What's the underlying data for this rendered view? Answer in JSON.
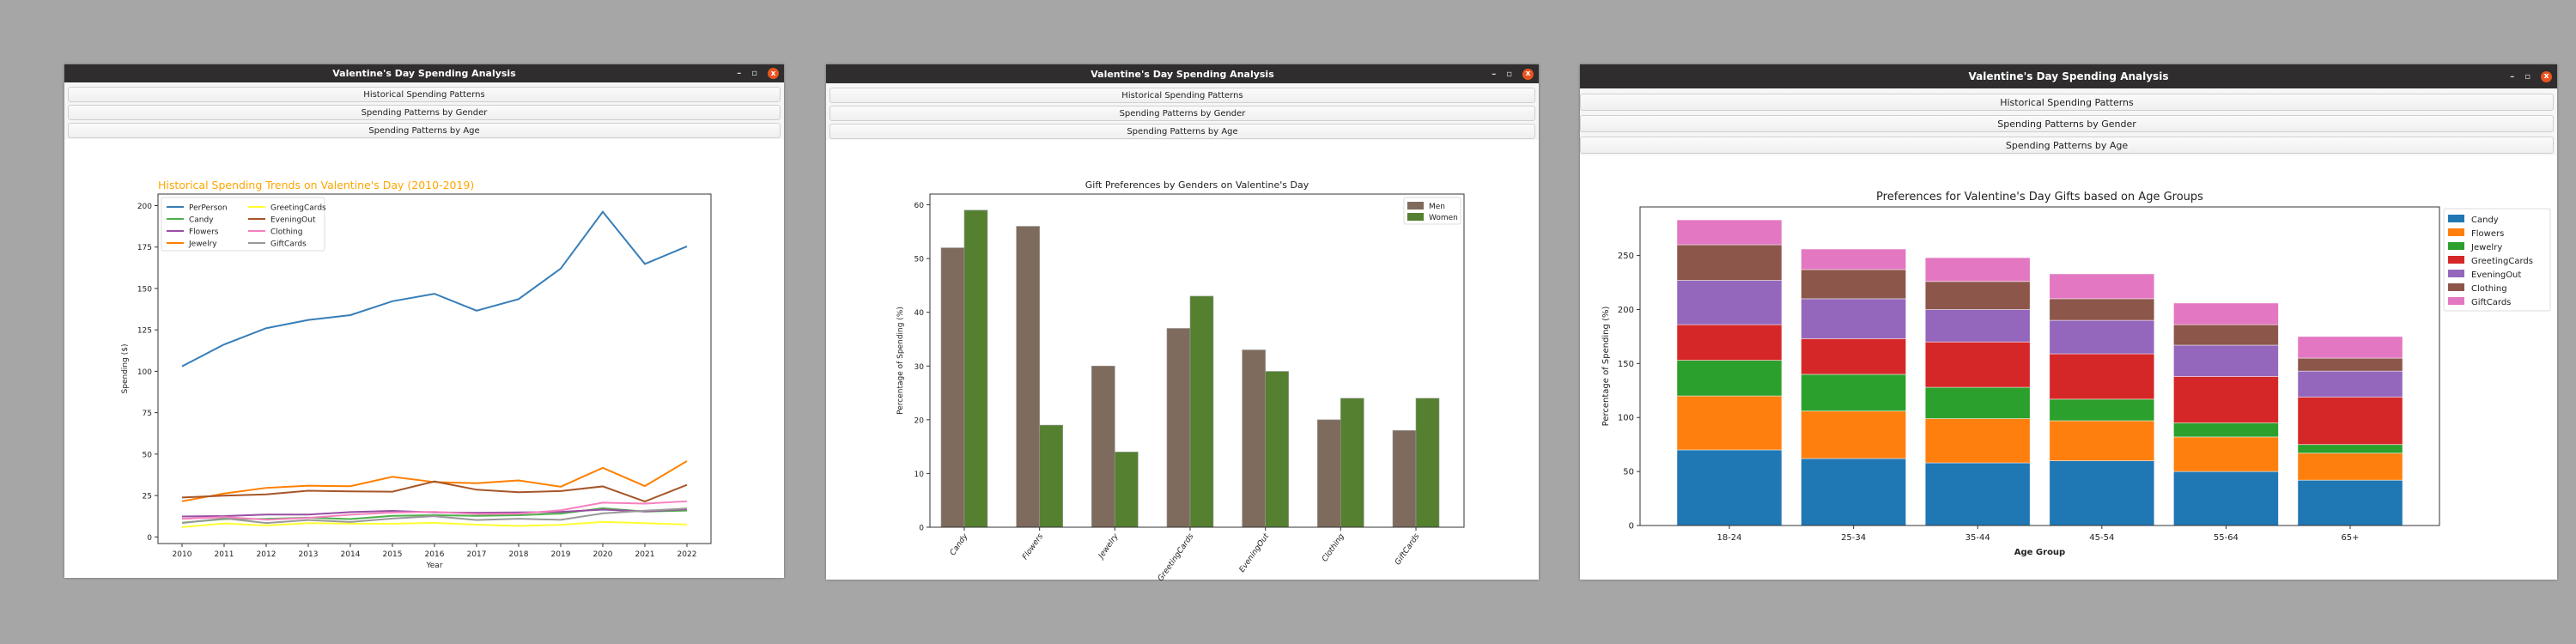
{
  "windows": [
    {
      "title": "Valentine's Day Spending Analysis",
      "buttons": [
        "Historical Spending Patterns",
        "Spending Patterns by Gender",
        "Spending Patterns by Age"
      ],
      "controls": {
        "minimize": "–",
        "maximize": "▫",
        "close": "x"
      }
    },
    {
      "title": "Valentine's Day Spending Analysis",
      "buttons": [
        "Historical Spending Patterns",
        "Spending Patterns by Gender",
        "Spending Patterns by Age"
      ],
      "controls": {
        "minimize": "–",
        "maximize": "▫",
        "close": "x"
      }
    },
    {
      "title": "Valentine's Day Spending Analysis",
      "buttons": [
        "Historical Spending Patterns",
        "Spending Patterns by Gender",
        "Spending Patterns by Age"
      ],
      "controls": {
        "minimize": "–",
        "maximize": "▫",
        "close": "x"
      }
    }
  ],
  "chart_data": [
    {
      "type": "line",
      "title": "Historical Spending Trends on Valentine's Day (2010-2019)",
      "title_color": "#ffa500",
      "xlabel": "Year",
      "ylabel": "Spending ($)",
      "x": [
        2010,
        2011,
        2012,
        2013,
        2014,
        2015,
        2016,
        2017,
        2018,
        2019,
        2020,
        2021,
        2022
      ],
      "ylim": [
        -4,
        207
      ],
      "yticks": [
        0,
        25,
        50,
        75,
        100,
        125,
        150,
        175,
        200
      ],
      "legend": "top-left",
      "series": [
        {
          "name": "PerPerson",
          "color": "#377eb8",
          "values": [
            103,
            116.2,
            126,
            131,
            133.9,
            142.3,
            146.8,
            136.6,
            143.6,
            162,
            196.3,
            164.8,
            175.4
          ]
        },
        {
          "name": "Candy",
          "color": "#4daf4a",
          "values": [
            8.6,
            10.8,
            10.9,
            11.6,
            10.8,
            12.7,
            13.1,
            12.7,
            13.1,
            14.1,
            17.3,
            15.3,
            15.9
          ]
        },
        {
          "name": "Flowers",
          "color": "#984ea3",
          "values": [
            12.3,
            12.6,
            13.5,
            13.5,
            15,
            15.7,
            14.8,
            14.6,
            14.8,
            15.1,
            16.5,
            15.4,
            16.7
          ]
        },
        {
          "name": "Jewelry",
          "color": "#ff7f00",
          "values": [
            21.5,
            26.2,
            29.6,
            30.9,
            30.6,
            36.3,
            33.1,
            32.4,
            34.1,
            30.3,
            41.7,
            30.7,
            45.8
          ]
        },
        {
          "name": "GreetingCards",
          "color": "#ffff33",
          "values": [
            5.9,
            8.1,
            6.9,
            8.3,
            8,
            7.9,
            8.5,
            7.4,
            6.6,
            7.3,
            9,
            8.3,
            7.5
          ]
        },
        {
          "name": "EveningOut",
          "color": "#a65628",
          "values": [
            23.8,
            24.9,
            25.7,
            27.9,
            27.5,
            27.3,
            33.5,
            28.5,
            27,
            27.7,
            30.5,
            21.4,
            31.4
          ]
        },
        {
          "name": "Clothing",
          "color": "#f781bf",
          "values": [
            10.9,
            12,
            10.4,
            11.5,
            13.4,
            14.7,
            15.1,
            13.9,
            14,
            16.1,
            20.7,
            20.1,
            21.5
          ]
        },
        {
          "name": "GiftCards",
          "color": "#999999",
          "values": [
            8.4,
            11.2,
            8.4,
            10.2,
            9,
            11.1,
            12.5,
            10.2,
            11,
            10.3,
            14.2,
            15.8,
            17.2
          ]
        }
      ]
    },
    {
      "type": "bar",
      "title": "Gift Preferences by Genders on Valentine's Day",
      "xlabel": "",
      "ylabel": "Percentage of Spending (%)",
      "categories": [
        "Candy",
        "Flowers",
        "Jewelry",
        "GreetingCards",
        "EveningOut",
        "Clothing",
        "GiftCards"
      ],
      "ylim": [
        0,
        62
      ],
      "yticks": [
        0,
        10,
        20,
        30,
        40,
        50,
        60
      ],
      "legend": "top-right",
      "series": [
        {
          "name": "Men",
          "color": "#7f6b5d",
          "values": [
            52,
            56,
            30,
            37,
            33,
            20,
            18
          ]
        },
        {
          "name": "Women",
          "color": "#548030",
          "values": [
            59,
            19,
            14,
            43,
            29,
            24,
            24
          ]
        }
      ]
    },
    {
      "type": "bar",
      "stacked": true,
      "title": "Preferences for Valentine's Day Gifts based on Age Groups",
      "xlabel": "Age Group",
      "ylabel": "Percentage of Spending (%)",
      "categories": [
        "18-24",
        "25-34",
        "35-44",
        "45-54",
        "55-64",
        "65+"
      ],
      "ylim": [
        0,
        295
      ],
      "yticks": [
        0,
        50,
        100,
        150,
        200,
        250
      ],
      "legend": "outside-right",
      "series": [
        {
          "name": "Candy",
          "color": "#1f77b4",
          "values": [
            70,
            62,
            58,
            60,
            50,
            42
          ]
        },
        {
          "name": "Flowers",
          "color": "#ff7f0e",
          "values": [
            50,
            44,
            41,
            37,
            32,
            25
          ]
        },
        {
          "name": "Jewelry",
          "color": "#2ca02c",
          "values": [
            33,
            34,
            29,
            20,
            13,
            8
          ]
        },
        {
          "name": "GreetingCards",
          "color": "#d62728",
          "values": [
            33,
            33,
            42,
            42,
            43,
            44
          ]
        },
        {
          "name": "EveningOut",
          "color": "#9467bd",
          "values": [
            41,
            37,
            30,
            31,
            29,
            24
          ]
        },
        {
          "name": "Clothing",
          "color": "#8c564b",
          "values": [
            33,
            27,
            26,
            20,
            19,
            12
          ]
        },
        {
          "name": "GiftCards",
          "color": "#e377c2",
          "values": [
            23,
            19,
            22,
            23,
            20,
            20
          ]
        }
      ]
    }
  ]
}
